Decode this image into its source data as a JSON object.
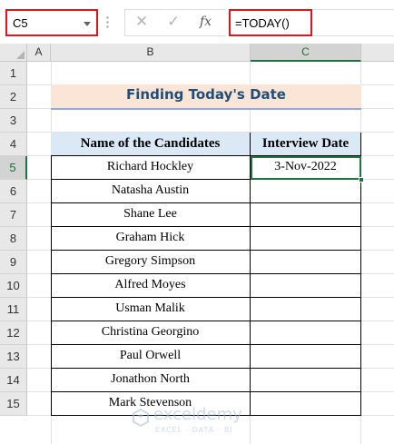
{
  "formula_bar": {
    "name_box": "C5",
    "formula": "=TODAY()",
    "fx_label": "fx"
  },
  "columns": [
    "A",
    "B",
    "C"
  ],
  "active_column": "C",
  "rows": [
    "1",
    "2",
    "3",
    "4",
    "5",
    "6",
    "7",
    "8",
    "9",
    "10",
    "11",
    "12",
    "13",
    "14",
    "15"
  ],
  "active_row": "5",
  "sheet": {
    "title": "Finding Today's Date",
    "table": {
      "headers": [
        "Name of the Candidates",
        "Interview Date"
      ],
      "rows": [
        [
          "Richard Hockley",
          "3-Nov-2022"
        ],
        [
          "Natasha Austin",
          ""
        ],
        [
          "Shane Lee",
          ""
        ],
        [
          "Graham Hick",
          ""
        ],
        [
          "Gregory Simpson",
          ""
        ],
        [
          "Alfred Moyes",
          ""
        ],
        [
          "Usman Malik",
          ""
        ],
        [
          "Christina Georgino",
          ""
        ],
        [
          "Paul Orwell",
          ""
        ],
        [
          "Jonathon North",
          ""
        ],
        [
          "Mark Stevenson",
          ""
        ]
      ]
    }
  },
  "watermark": {
    "name": "exceldemy",
    "tagline": "EXCEL · DATA · BI"
  },
  "colors": {
    "accent_green": "#217346",
    "title_fill": "#fbe5d6",
    "title_text": "#1f4e79",
    "header_fill": "#dbe9f7",
    "highlight_red": "#e0141c"
  }
}
